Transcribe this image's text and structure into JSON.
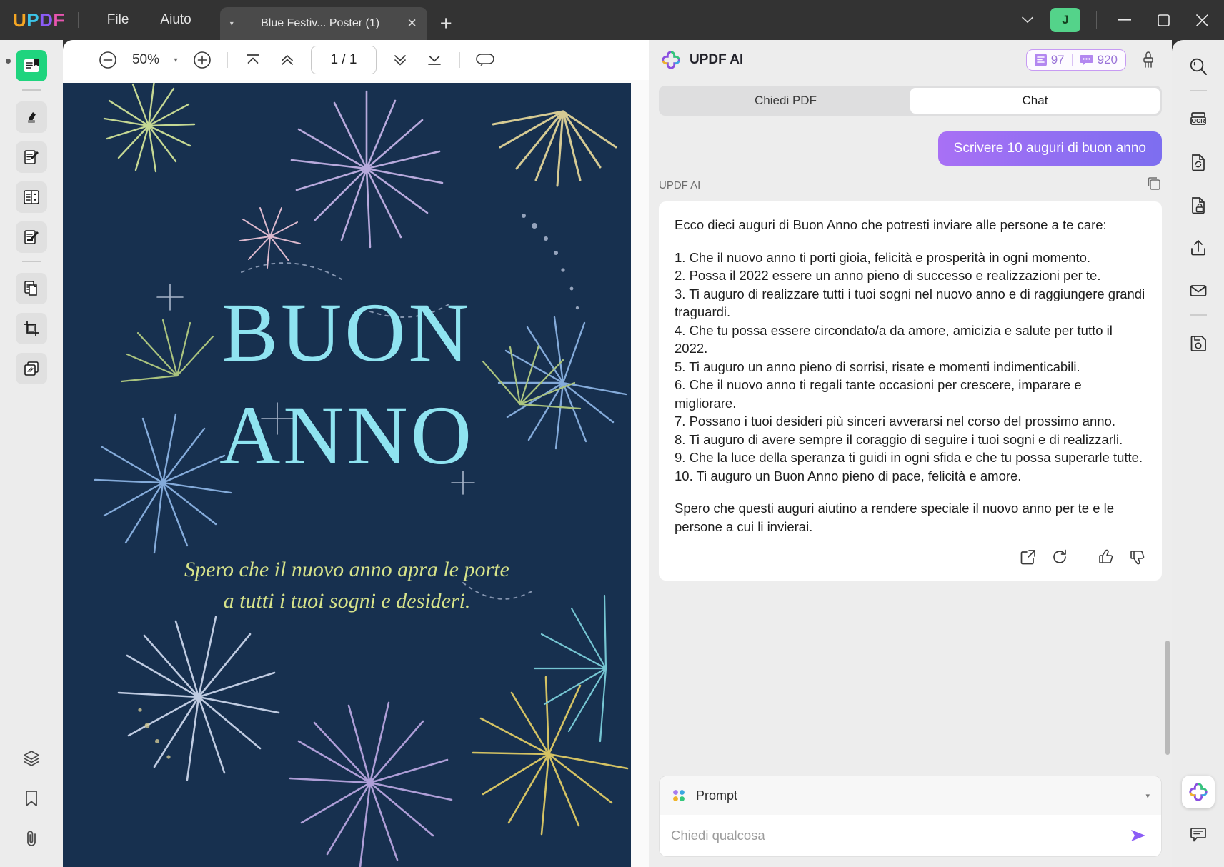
{
  "titlebar": {
    "logo": "UPDF",
    "logo_letters": [
      "U",
      "P",
      "D",
      "F"
    ],
    "menus": [
      "File",
      "Aiuto"
    ],
    "tab_title": "Blue Festiv... Poster (1)",
    "tab_close": "✕",
    "tab_caret": "▾",
    "new_tab": "+",
    "chevron": "⌄",
    "avatar": "J",
    "minimize": "—",
    "maximize": "☐",
    "close": "✕"
  },
  "left_rail": {
    "items": [
      {
        "name": "reader-view-icon",
        "label": "Lettore"
      },
      {
        "name": "highlight-icon",
        "label": "Evidenzia"
      },
      {
        "name": "edit-pdf-icon",
        "label": "Modifica PDF"
      },
      {
        "name": "organize-pages-icon",
        "label": "Organizza pagine"
      },
      {
        "name": "fill-sign-icon",
        "label": "Compila e firma"
      },
      {
        "name": "convert-page-icon",
        "label": "Converti"
      },
      {
        "name": "crop-icon",
        "label": "Ritaglia"
      },
      {
        "name": "batch-icon",
        "label": "Batch"
      }
    ],
    "bottom_items": [
      {
        "name": "layers-icon",
        "label": "Livelli"
      },
      {
        "name": "bookmark-icon",
        "label": "Segnalibro"
      },
      {
        "name": "attachment-icon",
        "label": "Allegati"
      }
    ]
  },
  "doc_toolbar": {
    "zoom_out": "−",
    "zoom_value": "50%",
    "zoom_caret": "▾",
    "zoom_in": "+",
    "first_page": "first-page",
    "prev_page": "prev-page",
    "page_indicator": "1 / 1",
    "next_page": "next-page",
    "last_page": "last-page",
    "view_mode": "view-mode"
  },
  "document": {
    "title_line1": "BUON",
    "title_line2": "ANNO",
    "subtitle_line1": "Spero che il nuovo anno apra le porte",
    "subtitle_line2": "a tutti i tuoi sogni e desideri.",
    "bg_color": "#17304f",
    "title_color": "#8fe3f0",
    "subtitle_color": "#d7e38a"
  },
  "ai_panel": {
    "title": "UPDF AI",
    "credits": {
      "docs": "97",
      "chats": "920"
    },
    "tabs": [
      {
        "id": "ask-pdf",
        "label": "Chiedi PDF",
        "active": false
      },
      {
        "id": "chat",
        "label": "Chat",
        "active": true
      }
    ],
    "user_message": "Scrivere 10 auguri di buon anno",
    "assistant_name": "UPDF AI",
    "assistant_message": {
      "intro": "Ecco dieci auguri di Buon Anno che potresti inviare alle persone a te care:",
      "items": [
        "1. Che il nuovo anno ti porti gioia, felicità e prosperità in ogni momento.",
        "2. Possa il 2022 essere un anno pieno di successo e realizzazioni per te.",
        "3. Ti auguro di realizzare tutti i tuoi sogni nel nuovo anno e di raggiungere grandi traguardi.",
        "4. Che tu possa essere circondato/a da amore, amicizia e salute per tutto il 2022.",
        "5. Ti auguro un anno pieno di sorrisi, risate e momenti indimenticabili.",
        "6. Che il nuovo anno ti regali tante occasioni per crescere, imparare e migliorare.",
        "7. Possano i tuoi desideri più sinceri avverarsi nel corso del prossimo anno.",
        "8. Ti auguro di avere sempre il coraggio di seguire i tuoi sogni e di realizzarli.",
        "9. Che la luce della speranza ti guidi in ogni sfida e che tu possa superarle tutte.",
        "10. Ti auguro un Buon Anno pieno di pace, felicità e amore."
      ],
      "outro": "Spero che questi auguri aiutino a rendere speciale il nuovo anno per te e le persone a cui li invierai."
    },
    "message_actions": [
      "export-icon",
      "regenerate-icon",
      "thumbs-up-icon",
      "thumbs-down-icon"
    ],
    "prompt": {
      "label": "Prompt",
      "caret": "▾",
      "input_value": "",
      "placeholder": "Chiedi qualcosa",
      "send": "send-icon"
    }
  },
  "right_rail": {
    "items": [
      {
        "name": "search-icon",
        "label": "Cerca"
      },
      {
        "name": "ocr-icon",
        "label": "OCR"
      },
      {
        "name": "convert-icon",
        "label": "Converti"
      },
      {
        "name": "protect-icon",
        "label": "Proteggi"
      },
      {
        "name": "share-icon",
        "label": "Condividi"
      },
      {
        "name": "email-icon",
        "label": "Email"
      },
      {
        "name": "save-icon",
        "label": "Salva"
      }
    ],
    "bottom_items": [
      {
        "name": "updf-ai-icon",
        "label": "UPDF AI"
      },
      {
        "name": "comment-icon",
        "label": "Commenti"
      }
    ]
  }
}
